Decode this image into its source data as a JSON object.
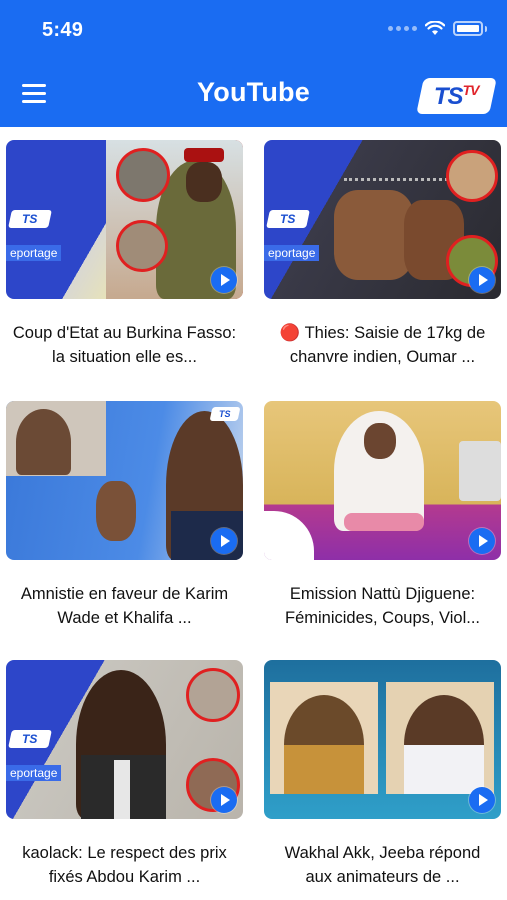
{
  "status_bar": {
    "time": "5:49"
  },
  "header": {
    "title": "YouTube",
    "logo_text": "TS",
    "logo_sub": "TV"
  },
  "videos": [
    {
      "caption": "Coup d'Etat au Burkina Fasso: la situation elle es..."
    },
    {
      "caption": "🔴 Thies: Saisie de 17kg de chanvre indien, Oumar ..."
    },
    {
      "caption": "Amnistie en faveur de Karim Wade et  Khalifa ..."
    },
    {
      "caption": "Emission Nattù Djiguene: Féminicides, Coups, Viol..."
    },
    {
      "caption": "kaolack: Le respect des prix fixés Abdou Karim ..."
    },
    {
      "caption": "Wakhal Akk, Jeeba répond aux animateurs de ..."
    }
  ],
  "thumb_labels": {
    "reportage": "eportage"
  },
  "colors": {
    "accent": "#1a6cf2",
    "logo_red": "#e0242b"
  }
}
